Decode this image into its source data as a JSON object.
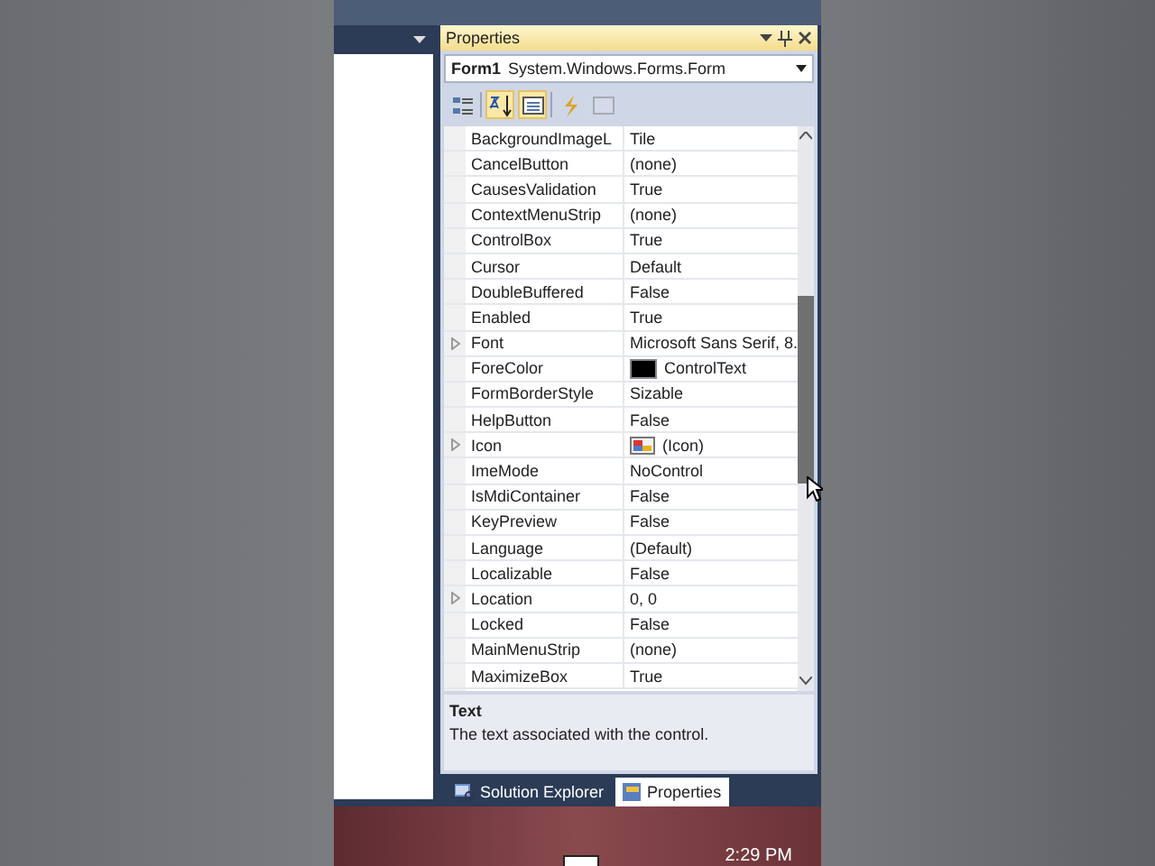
{
  "properties_window": {
    "title": "Properties",
    "object": {
      "name": "Form1",
      "type": "System.Windows.Forms.Form"
    },
    "toolbar": [
      {
        "kind": "categorized",
        "selected": false,
        "disabled": false
      },
      {
        "kind": "alphabetical",
        "selected": true,
        "disabled": false
      },
      {
        "kind": "properties",
        "selected": true,
        "disabled": false
      },
      {
        "kind": "events",
        "selected": false,
        "disabled": false
      },
      {
        "kind": "pages",
        "selected": false,
        "disabled": true
      }
    ],
    "rows": [
      {
        "name": "BackgroundImageL",
        "value": "Tile",
        "kind": "text",
        "expandable": false
      },
      {
        "name": "CancelButton",
        "value": "(none)",
        "kind": "text",
        "expandable": false
      },
      {
        "name": "CausesValidation",
        "value": "True",
        "kind": "text",
        "expandable": false
      },
      {
        "name": "ContextMenuStrip",
        "value": "(none)",
        "kind": "text",
        "expandable": false
      },
      {
        "name": "ControlBox",
        "value": "True",
        "kind": "text",
        "expandable": false
      },
      {
        "name": "Cursor",
        "value": "Default",
        "kind": "text",
        "expandable": false
      },
      {
        "name": "DoubleBuffered",
        "value": "False",
        "kind": "text",
        "expandable": false
      },
      {
        "name": "Enabled",
        "value": "True",
        "kind": "text",
        "expandable": false
      },
      {
        "name": "Font",
        "value": "Microsoft Sans Serif, 8.",
        "kind": "text",
        "expandable": true
      },
      {
        "name": "ForeColor",
        "value": "ControlText",
        "kind": "color",
        "color": "#000000",
        "expandable": false
      },
      {
        "name": "FormBorderStyle",
        "value": "Sizable",
        "kind": "text",
        "expandable": false
      },
      {
        "name": "HelpButton",
        "value": "False",
        "kind": "text",
        "expandable": false
      },
      {
        "name": "Icon",
        "value": "(Icon)",
        "kind": "image",
        "expandable": true
      },
      {
        "name": "ImeMode",
        "value": "NoControl",
        "kind": "text",
        "expandable": false
      },
      {
        "name": "IsMdiContainer",
        "value": "False",
        "kind": "text",
        "expandable": false
      },
      {
        "name": "KeyPreview",
        "value": "False",
        "kind": "text",
        "expandable": false
      },
      {
        "name": "Language",
        "value": "(Default)",
        "kind": "text",
        "expandable": false
      },
      {
        "name": "Localizable",
        "value": "False",
        "kind": "text",
        "expandable": false
      },
      {
        "name": "Location",
        "value": "0, 0",
        "kind": "text",
        "expandable": true
      },
      {
        "name": "Locked",
        "value": "False",
        "kind": "text",
        "expandable": false
      },
      {
        "name": "MainMenuStrip",
        "value": "(none)",
        "kind": "text",
        "expandable": false
      },
      {
        "name": "MaximizeBox",
        "value": "True",
        "kind": "text",
        "expandable": false
      }
    ],
    "description": {
      "title": "Text",
      "text": "The text associated with the control."
    },
    "tabs": [
      {
        "label": "Solution Explorer",
        "selected": false
      },
      {
        "label": "Properties",
        "selected": true
      }
    ]
  },
  "taskbar": {
    "time": "2:29 PM"
  }
}
